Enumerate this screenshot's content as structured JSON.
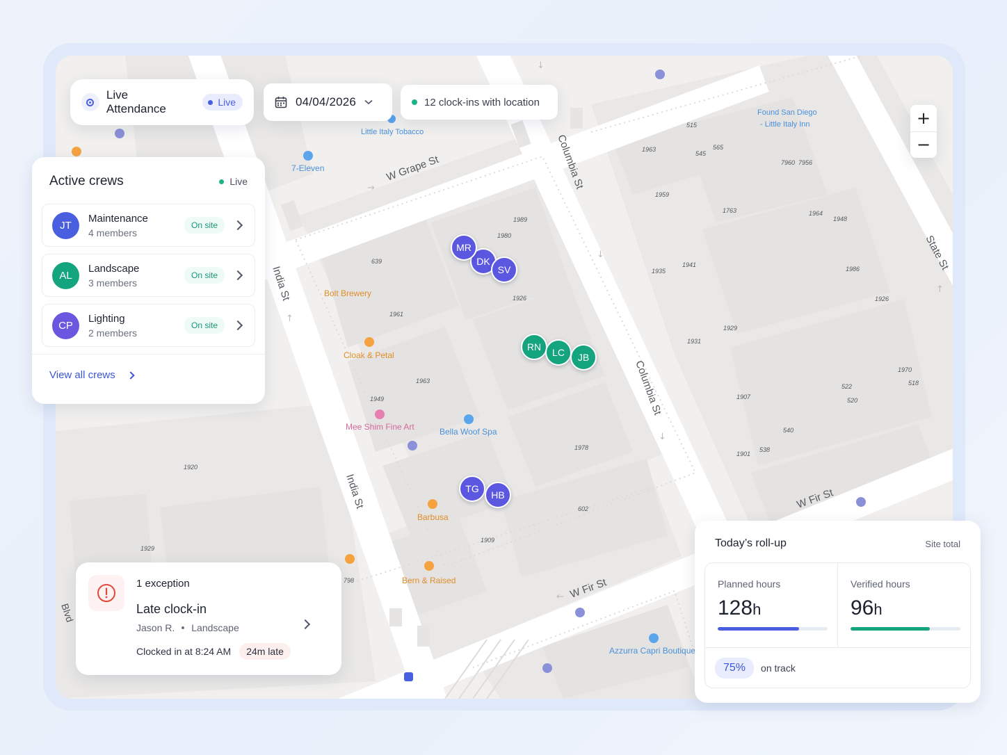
{
  "header": {
    "title": "Live Attendance",
    "live_badge": "Live",
    "date": "04/04/2026",
    "clockins": "12 clock-ins with location"
  },
  "zoom": {
    "in": "+",
    "out": "−"
  },
  "crews_panel": {
    "title": "Active crews",
    "live": "Live",
    "crews": [
      {
        "initials": "JT",
        "name": "Maintenance",
        "members": "4 members",
        "status": "On site",
        "color": "#4a5fe0"
      },
      {
        "initials": "AL",
        "name": "Landscape",
        "members": "3 members",
        "status": "On site",
        "color": "#14a57f"
      },
      {
        "initials": "CP",
        "name": "Lighting",
        "members": "2 members",
        "status": "On site",
        "color": "#6a57e0"
      }
    ],
    "view_all": "View all crews"
  },
  "exception": {
    "count": "1 exception",
    "title": "Late clock-in",
    "person": "Jason R.",
    "crew": "Landscape",
    "clocked": "Clocked in at 8:24 AM",
    "late": "24m late"
  },
  "rollup": {
    "title": "Today’s roll-up",
    "scope": "Site total",
    "planned_label": "Planned hours",
    "planned_value": "128",
    "planned_unit": "h",
    "planned_fill": 0.74,
    "verified_label": "Verified hours",
    "verified_value": "96",
    "verified_unit": "h",
    "verified_fill": 0.72,
    "percent": "75%",
    "status": "on track",
    "colors": {
      "planned": "#4a5fe0",
      "verified": "#14a57f"
    }
  },
  "map": {
    "streets": [
      "W Grape St",
      "Columbia St",
      "India St",
      "India St",
      "Columbia St",
      "State St",
      "W Fir St",
      "W Fir St",
      "Kettner Blvd"
    ],
    "pois": [
      "Little Italy Tobacco",
      "7-Eleven",
      "Bolt Brewery",
      "Cloak & Petal",
      "Mee Shim Fine Art",
      "Bella Woof Spa",
      "Barbusa",
      "Bern & Raised",
      "Azzurra Capri Boutique",
      "Found San Diego",
      "- Little Italy Inn"
    ],
    "address_numbers": [
      "515",
      "545",
      "565",
      "1963",
      "7960",
      "7956",
      "1959",
      "1763",
      "1964",
      "1948",
      "1935",
      "1941",
      "1986",
      "1926",
      "1929",
      "1931",
      "1970",
      "518",
      "522",
      "520",
      "1907",
      "540",
      "538",
      "1901",
      "1989",
      "1980",
      "639",
      "1926",
      "1961",
      "1963",
      "1949",
      "1978",
      "1920",
      "1929",
      "602",
      "1909",
      "798"
    ],
    "pins": [
      {
        "initials": "MR",
        "crew": "indigo"
      },
      {
        "initials": "DK",
        "crew": "indigo"
      },
      {
        "initials": "SV",
        "crew": "indigo"
      },
      {
        "initials": "RN",
        "crew": "green"
      },
      {
        "initials": "LC",
        "crew": "green"
      },
      {
        "initials": "JB",
        "crew": "green"
      },
      {
        "initials": "TG",
        "crew": "indigo"
      },
      {
        "initials": "HB",
        "crew": "indigo"
      }
    ]
  }
}
